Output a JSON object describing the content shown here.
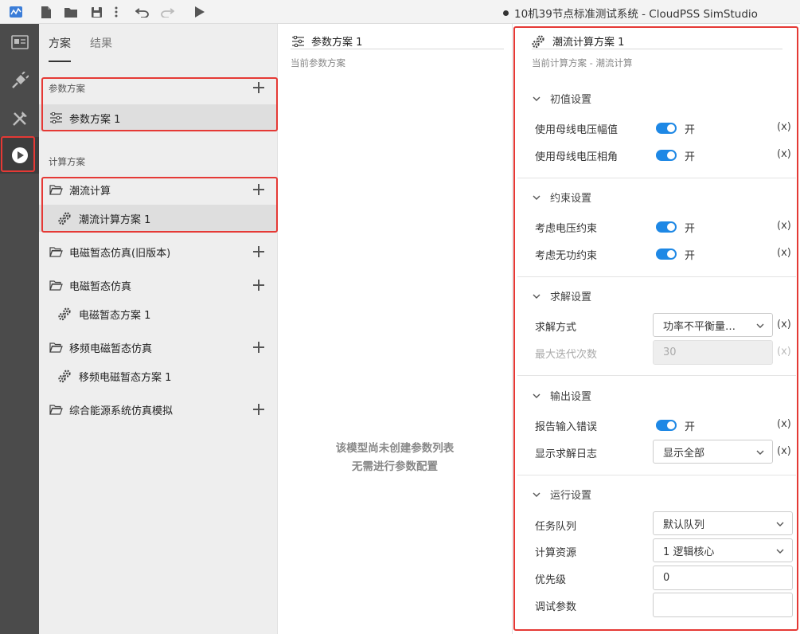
{
  "window": {
    "title": "10机39节点标准测试系统 - CloudPSS SimStudio"
  },
  "scheme_panel": {
    "tabs": [
      "方案",
      "结果"
    ],
    "param_section_label": "参数方案",
    "param_items": [
      "参数方案 1"
    ],
    "calc_section_label": "计算方案",
    "calc_groups": [
      {
        "label": "潮流计算",
        "children": [
          "潮流计算方案 1"
        ]
      },
      {
        "label": "电磁暂态仿真(旧版本)",
        "children": []
      },
      {
        "label": "电磁暂态仿真",
        "children": [
          "电磁暂态方案 1"
        ]
      },
      {
        "label": "移频电磁暂态仿真",
        "children": [
          "移频电磁暂态方案 1"
        ]
      },
      {
        "label": "综合能源系统仿真模拟",
        "children": []
      }
    ]
  },
  "middle_panel": {
    "title": "参数方案 1",
    "subtitle": "当前参数方案",
    "empty_line1": "该模型尚未创建参数列表",
    "empty_line2": "无需进行参数配置"
  },
  "right_panel": {
    "title": "潮流计算方案 1",
    "subtitle": "当前计算方案 - 潮流计算",
    "groups": {
      "initial": {
        "label": "初值设置",
        "use_bus_voltage_mag": {
          "label": "使用母线电压幅值",
          "state": "开",
          "on": true,
          "expr": "(x)"
        },
        "use_bus_voltage_angle": {
          "label": "使用母线电压相角",
          "state": "开",
          "on": true,
          "expr": "(x)"
        }
      },
      "constraint": {
        "label": "约束设置",
        "voltage": {
          "label": "考虑电压约束",
          "state": "开",
          "on": true,
          "expr": "(x)"
        },
        "reactive": {
          "label": "考虑无功约束",
          "state": "开",
          "on": true,
          "expr": "(x)"
        }
      },
      "solve": {
        "label": "求解设置",
        "method": {
          "label": "求解方式",
          "value": "功率不平衡量…",
          "expr": "(x)"
        },
        "max_iter": {
          "label": "最大迭代次数",
          "value": "30",
          "expr": "(x)"
        }
      },
      "output": {
        "label": "输出设置",
        "report_error": {
          "label": "报告输入错误",
          "state": "开",
          "on": true,
          "expr": "(x)"
        },
        "log": {
          "label": "显示求解日志",
          "value": "显示全部",
          "expr": "(x)"
        }
      },
      "run": {
        "label": "运行设置",
        "queue": {
          "label": "任务队列",
          "value": "默认队列"
        },
        "resource": {
          "label": "计算资源",
          "value": "1 逻辑核心"
        },
        "priority": {
          "label": "优先级",
          "value": "0"
        },
        "debug": {
          "label": "调试参数",
          "value": ""
        }
      }
    }
  },
  "colors": {
    "accent": "#1e88e5",
    "highlight": "#e53935",
    "activity_bar": "#4b4b4b"
  }
}
